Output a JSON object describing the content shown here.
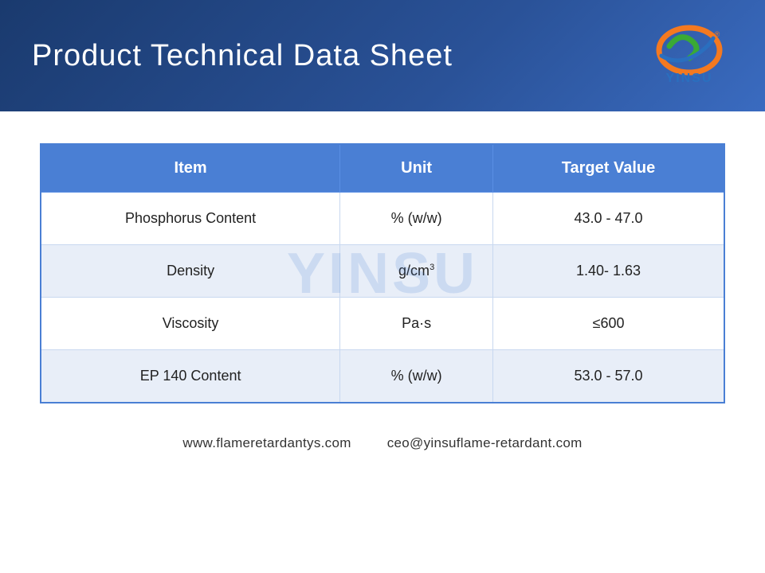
{
  "header": {
    "title": "Product Technical Data Sheet",
    "logo_text": "YINSU"
  },
  "table": {
    "columns": [
      "Item",
      "Unit",
      "Target Value"
    ],
    "rows": [
      {
        "item": "Phosphorus Content",
        "unit": "% (w/w)",
        "unit_special": false,
        "target": "43.0 - 47.0"
      },
      {
        "item": "Density",
        "unit": "g/cm",
        "unit_special": true,
        "target": "1.40- 1.63"
      },
      {
        "item": "Viscosity",
        "unit": "Pa·s",
        "unit_special": false,
        "target": "≤600"
      },
      {
        "item": "EP 140 Content",
        "unit": "% (w/w)",
        "unit_special": false,
        "target": "53.0 - 57.0"
      }
    ],
    "watermark": "YINSU"
  },
  "footer": {
    "website": "www.flameretardantys.com",
    "email": "ceo@yinsuflame-retardant.com"
  }
}
